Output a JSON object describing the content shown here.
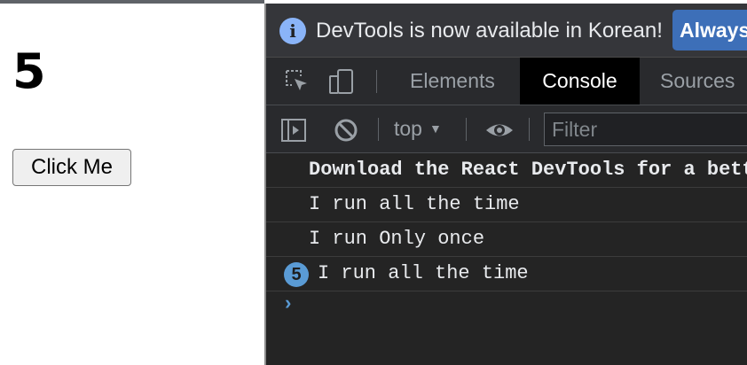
{
  "app": {
    "counter_value": "5",
    "button_label": "Click Me"
  },
  "devtools": {
    "infobar": {
      "icon": "info-icon",
      "icon_glyph": "i",
      "message": "DevTools is now available in Korean!",
      "always_label": "Always"
    },
    "tabs": [
      {
        "label": "Elements",
        "active": false
      },
      {
        "label": "Console",
        "active": true
      },
      {
        "label": "Sources",
        "active": false
      }
    ],
    "toolbar": {
      "context": "top",
      "filter_placeholder": "Filter"
    },
    "console_messages": [
      {
        "text": "Download the React DevTools for a bett",
        "bold": true
      },
      {
        "text": "I run all the time"
      },
      {
        "text": "I run Only once"
      },
      {
        "text": "I run all the time",
        "repeat_count": "5"
      }
    ],
    "prompt_symbol": "›",
    "colors": {
      "accent_blue": "#8ab4f8",
      "badge_blue": "#5a9bd5",
      "panel_bg": "#242424"
    }
  }
}
